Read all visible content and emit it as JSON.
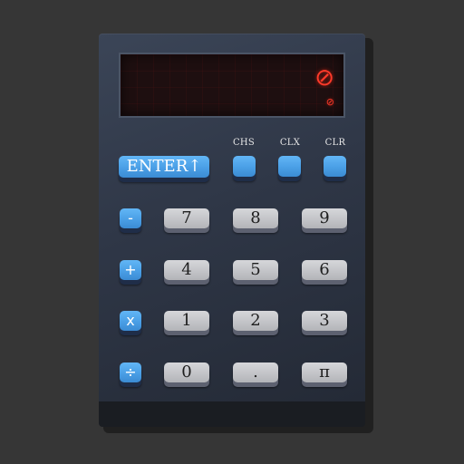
{
  "display": {
    "main": "⊘",
    "sub": "⊘"
  },
  "function_labels": {
    "chs": "CHS",
    "clx": "CLX",
    "clr": "CLR"
  },
  "keys": {
    "enter": "ENTER↑",
    "minus": "-",
    "plus": "+",
    "multiply": "x",
    "divide": "÷",
    "seven": "7",
    "eight": "8",
    "nine": "9",
    "four": "4",
    "five": "5",
    "six": "6",
    "one": "1",
    "two": "2",
    "three": "3",
    "zero": "0",
    "decimal": ".",
    "pi": "π"
  },
  "colors": {
    "background": "#363636",
    "body": "#2f3747",
    "display_bg": "#1e0f10",
    "led": "#ff3a2a",
    "key_blue": "#4a9fe6",
    "key_gray": "#c3c4c8"
  }
}
